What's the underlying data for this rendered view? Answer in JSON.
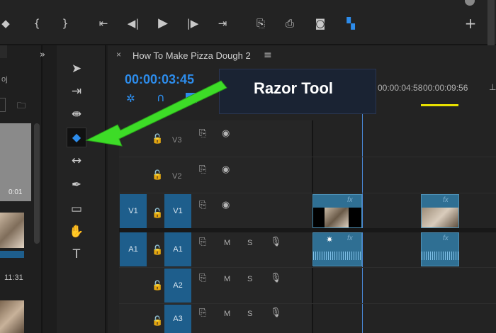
{
  "sequence": {
    "tab_title": "How To Make Pizza Dough 2",
    "timecode": "00:00:03:45"
  },
  "ruler": {
    "marks": [
      "00:00:04:58",
      "00:00:09:56"
    ]
  },
  "callout": {
    "text": "Razor Tool"
  },
  "tracks": {
    "video": [
      {
        "name": "V3"
      },
      {
        "name": "V2"
      },
      {
        "name": "V1",
        "source": "V1"
      }
    ],
    "audio": [
      {
        "name": "A1",
        "source": "A1",
        "mute": "M",
        "solo": "S"
      },
      {
        "name": "A2",
        "mute": "M",
        "solo": "S"
      },
      {
        "name": "A3",
        "mute": "M",
        "solo": "S"
      }
    ]
  },
  "project": {
    "thumb_time_1": "0:01",
    "thumb_time_2": "11:31",
    "label": "oj"
  },
  "clip_fx": "fx",
  "colors": {
    "accent": "#2d8ceb",
    "track_blue": "#1e5e8c",
    "callout_arrow": "#3ddc27",
    "playhead": "#4a88d8",
    "work_area": "#e8e000"
  }
}
